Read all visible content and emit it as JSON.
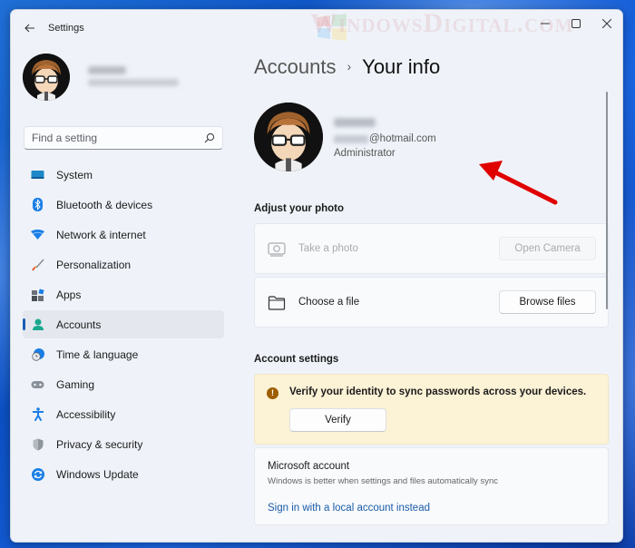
{
  "window": {
    "title": "Settings",
    "controls": [
      "minimize",
      "maximize",
      "close"
    ]
  },
  "watermark": "WindowsDigital.com",
  "sidebar": {
    "profile": {
      "name": "(blurred)",
      "email": "(blurred)"
    },
    "search": {
      "placeholder": "Find a setting",
      "value": ""
    },
    "items": [
      {
        "label": "System",
        "icon": "system-icon",
        "active": false
      },
      {
        "label": "Bluetooth & devices",
        "icon": "bluetooth-icon",
        "active": false
      },
      {
        "label": "Network & internet",
        "icon": "wifi-icon",
        "active": false
      },
      {
        "label": "Personalization",
        "icon": "brush-icon",
        "active": false
      },
      {
        "label": "Apps",
        "icon": "apps-icon",
        "active": false
      },
      {
        "label": "Accounts",
        "icon": "accounts-icon",
        "active": true
      },
      {
        "label": "Time & language",
        "icon": "time-language-icon",
        "active": false
      },
      {
        "label": "Gaming",
        "icon": "gaming-icon",
        "active": false
      },
      {
        "label": "Accessibility",
        "icon": "accessibility-icon",
        "active": false
      },
      {
        "label": "Privacy & security",
        "icon": "shield-icon",
        "active": false
      },
      {
        "label": "Windows Update",
        "icon": "update-icon",
        "active": false
      }
    ]
  },
  "main": {
    "breadcrumb": {
      "parent": "Accounts",
      "separator": "›",
      "current": "Your info"
    },
    "user": {
      "email_domain": "@hotmail.com",
      "role": "Administrator"
    },
    "adjust_photo": {
      "title": "Adjust your photo",
      "take_photo": {
        "label": "Take a photo",
        "button": "Open Camera",
        "disabled": true
      },
      "choose_file": {
        "label": "Choose a file",
        "button": "Browse files",
        "disabled": false
      }
    },
    "account_settings": {
      "title": "Account settings",
      "verify": {
        "message": "Verify your identity to sync passwords across your devices.",
        "button": "Verify"
      },
      "microsoft_account": {
        "title": "Microsoft account",
        "description": "Windows is better when settings and files automatically sync",
        "link": "Sign in with a local account instead"
      }
    }
  },
  "colors": {
    "accent": "#1a5fb4",
    "link": "#1a5ca8",
    "warning_bg": "#fcf2d6",
    "warning_icon": "#9d5d00",
    "annotation_arrow": "#e00000"
  }
}
